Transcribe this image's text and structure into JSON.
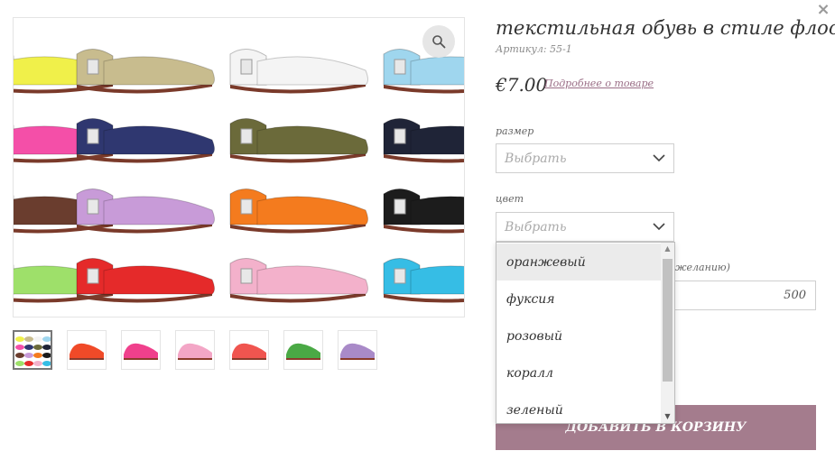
{
  "modal": {
    "close_glyph": "×"
  },
  "product": {
    "title": "текстильная обувь в стиле флосси",
    "sku": "Артикул: 55-1",
    "price": "€7.00",
    "details_link": "Подробнее о товаре"
  },
  "gallery": {
    "zoom_icon": "magnifier-icon",
    "thumbnails": [
      {
        "name": "multi",
        "color": "#8a7a5a"
      },
      {
        "name": "orange-red",
        "color": "#f04a28"
      },
      {
        "name": "pink",
        "color": "#f0408c"
      },
      {
        "name": "light-pink",
        "color": "#f3a6c6"
      },
      {
        "name": "coral",
        "color": "#f0554f"
      },
      {
        "name": "green",
        "color": "#4aa945"
      },
      {
        "name": "lilac",
        "color": "#a98ac8"
      }
    ],
    "grid_colors": [
      [
        "#f0f04a",
        "#c8bc8e",
        "#f4f4f4",
        "#9fd6ee"
      ],
      [
        "#f44fa8",
        "#2f3770",
        "#6b6a3a",
        "#1f2437"
      ],
      [
        "#6a3d2e",
        "#c89bd8",
        "#f47b1e",
        "#1c1c1c"
      ],
      [
        "#9ee06a",
        "#e52a2a",
        "#f3b1cb",
        "#36bde5"
      ]
    ]
  },
  "options": {
    "size": {
      "label": "размер",
      "value": "Выбрать"
    },
    "color": {
      "label": "цвет",
      "value": "Выбрать",
      "dropdown": [
        "оранжевый",
        "фуксия",
        "розовый",
        "коралл",
        "зеленый"
      ],
      "highlighted_index": 0
    },
    "extra": {
      "label_visible": "желанию)",
      "value": "500"
    }
  },
  "cart": {
    "add_button": "Добавить в корзину"
  },
  "colors": {
    "accent": "#a47c8d",
    "link": "#9a6e86"
  }
}
